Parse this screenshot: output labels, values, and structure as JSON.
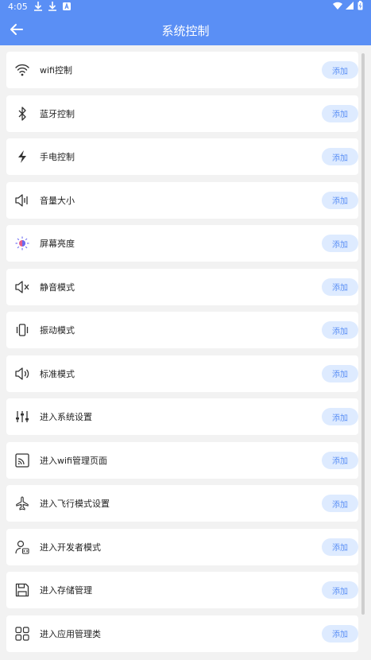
{
  "status": {
    "time": "4:05"
  },
  "header": {
    "title": "系统控制"
  },
  "items": [
    {
      "label": "wifi控制",
      "button": "添加",
      "icon": "wifi-icon"
    },
    {
      "label": "蓝牙控制",
      "button": "添加",
      "icon": "bluetooth-icon"
    },
    {
      "label": "手电控制",
      "button": "添加",
      "icon": "flashlight-icon"
    },
    {
      "label": "音量大小",
      "button": "添加",
      "icon": "volume-icon"
    },
    {
      "label": "屏幕亮度",
      "button": "添加",
      "icon": "brightness-icon"
    },
    {
      "label": "静音模式",
      "button": "添加",
      "icon": "mute-icon"
    },
    {
      "label": "振动模式",
      "button": "添加",
      "icon": "vibrate-icon"
    },
    {
      "label": "标准模式",
      "button": "添加",
      "icon": "sound-icon"
    },
    {
      "label": "进入系统设置",
      "button": "添加",
      "icon": "sliders-icon"
    },
    {
      "label": "进入wifi管理页面",
      "button": "添加",
      "icon": "wifi-page-icon"
    },
    {
      "label": "进入飞行模式设置",
      "button": "添加",
      "icon": "airplane-icon"
    },
    {
      "label": "进入开发者模式",
      "button": "添加",
      "icon": "developer-icon"
    },
    {
      "label": "进入存储管理",
      "button": "添加",
      "icon": "save-icon"
    },
    {
      "label": "进入应用管理类",
      "button": "添加",
      "icon": "apps-icon"
    }
  ],
  "colors": {
    "accent": "#5a8ff5",
    "button_bg": "#deebff"
  }
}
